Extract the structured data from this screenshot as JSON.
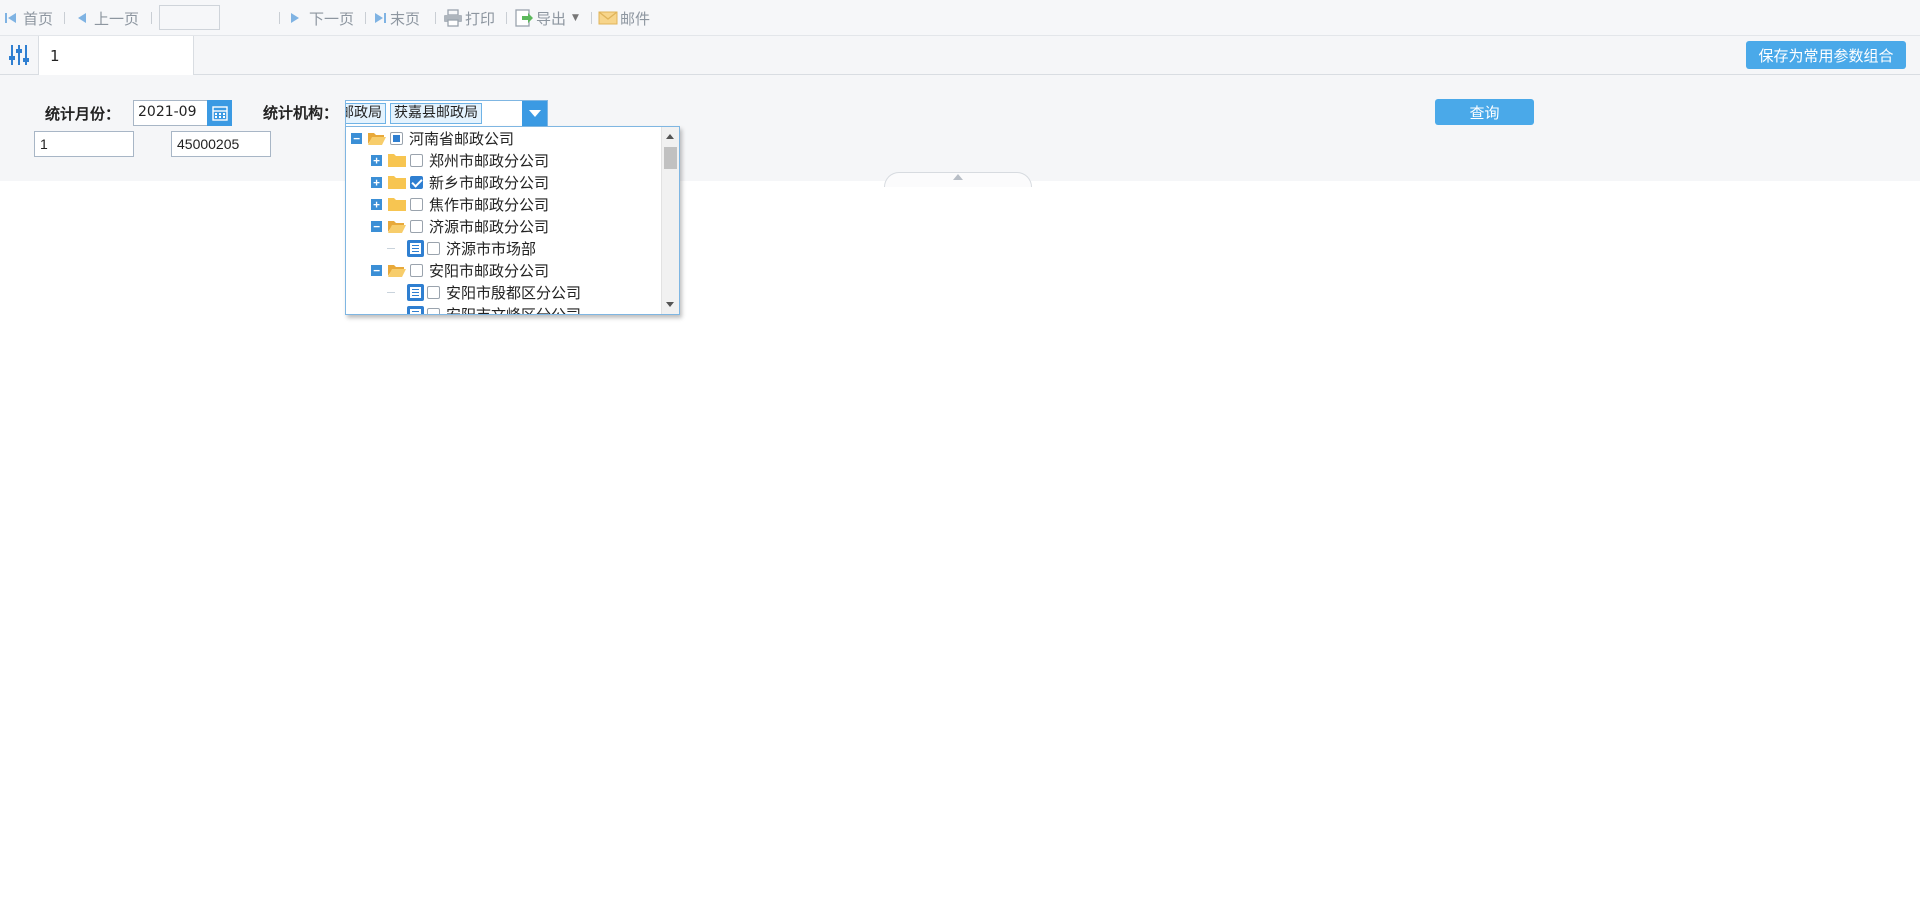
{
  "toolbar": {
    "first_label": "首页",
    "prev_label": "上一页",
    "page_value": "",
    "next_label": "下一页",
    "last_label": "末页",
    "print_label": "打印",
    "export_label": "导出",
    "mail_label": "邮件"
  },
  "param_bar": {
    "tab_label": "1",
    "save_label": "保存为常用参数组合"
  },
  "form": {
    "month_label": "统计月份：",
    "month_value": "2021-09",
    "org_label": "统计机构：",
    "org_tags": [
      "邮政局",
      "获嘉县邮政局"
    ],
    "query_label": "查询",
    "input1_value": "1",
    "input2_value": "45000205"
  },
  "tree": {
    "items": [
      {
        "label": "河南省邮政公司",
        "state": "partial",
        "expanded": true
      },
      {
        "label": "郑州市邮政分公司",
        "state": "unchecked",
        "expanded": false
      },
      {
        "label": "新乡市邮政分公司",
        "state": "checked",
        "expanded": false
      },
      {
        "label": "焦作市邮政分公司",
        "state": "unchecked",
        "expanded": false
      },
      {
        "label": "济源市邮政分公司",
        "state": "unchecked",
        "expanded": true
      },
      {
        "label": "济源市市场部",
        "state": "unchecked",
        "leaf": true
      },
      {
        "label": "安阳市邮政分公司",
        "state": "unchecked",
        "expanded": true
      },
      {
        "label": "安阳市殷都区分公司",
        "state": "unchecked",
        "leaf": true
      },
      {
        "label": "安阳市文峰区分公司",
        "state": "unchecked",
        "leaf": true
      }
    ]
  },
  "colors": {
    "accent": "#4aa9e9",
    "tree_blue": "#2f7fd1",
    "folder_yellow": "#f5c150"
  }
}
